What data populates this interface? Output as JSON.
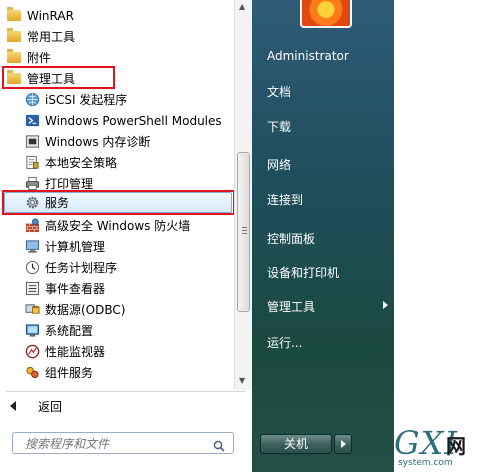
{
  "programs": [
    {
      "label": "WinRAR",
      "icon": "folder-icon"
    },
    {
      "label": "常用工具",
      "icon": "folder-icon"
    },
    {
      "label": "附件",
      "icon": "folder-icon"
    },
    {
      "label": "管理工具",
      "icon": "folder-icon"
    },
    {
      "label": "iSCSI 发起程序",
      "icon": "globe-icon"
    },
    {
      "label": "Windows PowerShell Modules",
      "icon": "powershell-icon"
    },
    {
      "label": "Windows 内存诊断",
      "icon": "memory-chip-icon"
    },
    {
      "label": "本地安全策略",
      "icon": "security-policy-icon"
    },
    {
      "label": "打印管理",
      "icon": "printer-icon"
    },
    {
      "label": "服务",
      "icon": "gear-icon"
    },
    {
      "label": "高级安全 Windows 防火墙",
      "icon": "firewall-icon"
    },
    {
      "label": "计算机管理",
      "icon": "computer-icon"
    },
    {
      "label": "任务计划程序",
      "icon": "clock-icon"
    },
    {
      "label": "事件查看器",
      "icon": "event-viewer-icon"
    },
    {
      "label": "数据源(ODBC)",
      "icon": "database-icon"
    },
    {
      "label": "系统配置",
      "icon": "system-config-icon"
    },
    {
      "label": "性能监视器",
      "icon": "performance-icon"
    },
    {
      "label": "组件服务",
      "icon": "components-icon"
    }
  ],
  "back_label": "返回",
  "search": {
    "placeholder": "搜索程序和文件"
  },
  "right_panel": {
    "items": [
      "Administrator",
      "文档",
      "下载",
      "网络",
      "连接到",
      "控制面板",
      "设备和打印机",
      "管理工具",
      "运行..."
    ]
  },
  "shutdown_label": "关机",
  "watermark": {
    "big": "GXI",
    "small": "system.com",
    "cn": "网"
  },
  "colors": {
    "highlight_border": "#e0141c",
    "right_panel": "#1f4d5a"
  }
}
